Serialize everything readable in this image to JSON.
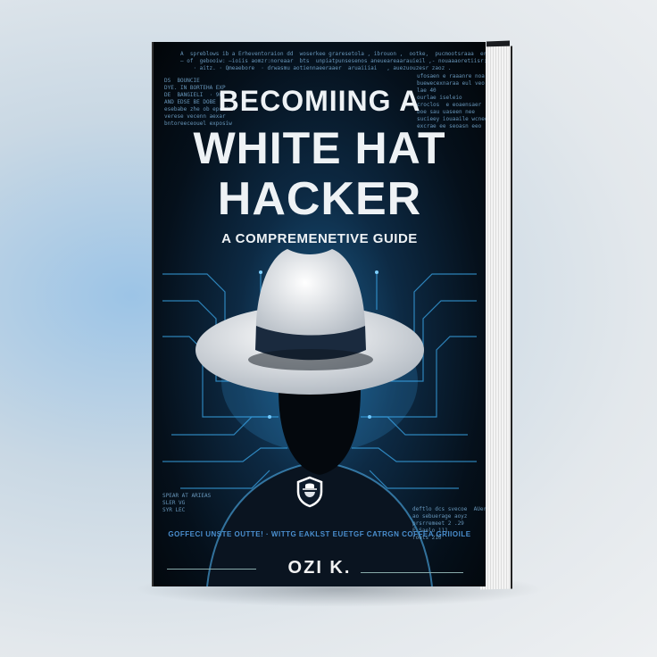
{
  "book": {
    "title_line1": "BECOMIING A",
    "title_line2": "WHITE HAT",
    "title_line3": "HACKER",
    "subtitle": "A COMPREMENETIVE GUIDE",
    "tagline": "GOFFECI UNSTE OUTTE! · WITTG EAKLST EUETGF CATRGN COFFEA GRIIOILE",
    "author": "OZI K.",
    "code_top": "A  spreblows ib a Erheventoraion dd  woserkee graresetola , ibrouon ,  ootke,  pucmootsraaa  erzanock . -\n— of  gebooiw: —ioiis aomzr:noreaar  bts  unpiatpunsesenos aneueareaarauieil ,- nouaaaoretiisr:-  uolanomeri\n    · aitz. · Qmeaebore  · drwasmu aotiennaeeraaer  aruaiiiai   , auezuouzesr zaoz .",
    "code_left": "DS  BOUNCIE\nDYE. IN BORTEHA EXP\nDE  BANGIELI  · 90\nAND EDSE BE DOBE\nesebabe zhe ob epcoion\nverese vecenn aexar\nbntoreeceouel exposiw",
    "code_right": "ufosaen e raaanre noa\nbuewecexnaraa eul veo\nlae 40\nourlae iseleio\ncroclos  e eoaensaer\nboe sau uaseen nee\nsucieey iouaaile wcneo\nexcrae ee seoasn eeo",
    "code_bottom_left": "SPEAR AT ARIEAS\nSLER VG\nSYR LEC",
    "code_bottom_right": "deftlo dcs svecoe  AUernaza\nao sebuerage aoyz\nprsrremeet 2 .29\nE Saelo 111\nfoets 210"
  },
  "colors": {
    "accent": "#4a8fcf",
    "cover": "#05101b",
    "hat": "#f0f2f4"
  }
}
